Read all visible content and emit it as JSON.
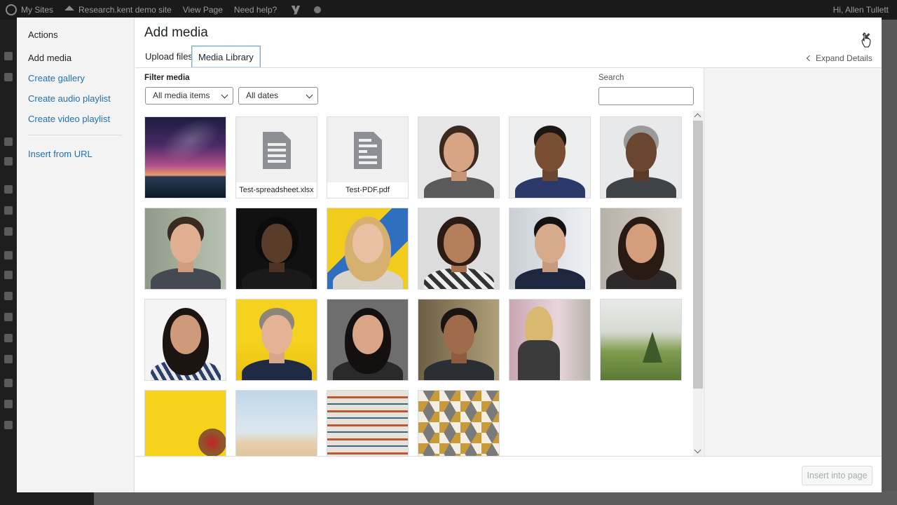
{
  "admin_bar": {
    "my_sites": "My Sites",
    "site_name": "Research.kent demo site",
    "view_page": "View Page",
    "need_help": "Need help?",
    "greeting": "Hi, Allen Tullett"
  },
  "modal": {
    "title": "Add media",
    "close_icon": "close-icon",
    "menu": {
      "heading": "Actions",
      "items": [
        {
          "label": "Add media",
          "active": true
        },
        {
          "label": "Create gallery"
        },
        {
          "label": "Create audio playlist"
        },
        {
          "label": "Create video playlist"
        }
      ],
      "insert_from_url": "Insert from URL"
    },
    "tabs": [
      {
        "label": "Upload files",
        "active": false
      },
      {
        "label": "Media Library",
        "active": true
      }
    ],
    "expand_details": "Expand Details",
    "filter": {
      "label": "Filter media",
      "type_selected": "All media items",
      "date_selected": "All dates"
    },
    "search": {
      "label": "Search",
      "value": "",
      "placeholder": ""
    },
    "attachments": [
      {
        "kind": "image",
        "subject": "night-sky-milky-way"
      },
      {
        "kind": "document",
        "filename": "Test-spreadsheet.xlsx",
        "icon": "spreadsheet-icon"
      },
      {
        "kind": "document",
        "filename": "Test-PDF.pdf",
        "icon": "document-icon"
      },
      {
        "kind": "image",
        "subject": "portrait-man"
      },
      {
        "kind": "image",
        "subject": "portrait-man"
      },
      {
        "kind": "image",
        "subject": "portrait-man"
      },
      {
        "kind": "image",
        "subject": "portrait-man"
      },
      {
        "kind": "image",
        "subject": "portrait-woman"
      },
      {
        "kind": "image",
        "subject": "portrait-woman"
      },
      {
        "kind": "image",
        "subject": "portrait-woman"
      },
      {
        "kind": "image",
        "subject": "portrait-man"
      },
      {
        "kind": "image",
        "subject": "portrait-woman"
      },
      {
        "kind": "image",
        "subject": "portrait-woman"
      },
      {
        "kind": "image",
        "subject": "portrait-man"
      },
      {
        "kind": "image",
        "subject": "portrait-woman"
      },
      {
        "kind": "image",
        "subject": "portrait-man"
      },
      {
        "kind": "image",
        "subject": "woman-back-street"
      },
      {
        "kind": "image",
        "subject": "misty-forest"
      },
      {
        "kind": "image",
        "subject": "yellow-wall-flowers"
      },
      {
        "kind": "image",
        "subject": "desert-dunes"
      },
      {
        "kind": "image",
        "subject": "shelves-of-books"
      },
      {
        "kind": "image",
        "subject": "geometric-tile-pattern"
      }
    ],
    "insert_button": "Insert into page"
  },
  "colors": {
    "link": "#2271b1",
    "active_tab_border": "#72aee6",
    "admin_bar_bg": "#1a1a1a"
  }
}
